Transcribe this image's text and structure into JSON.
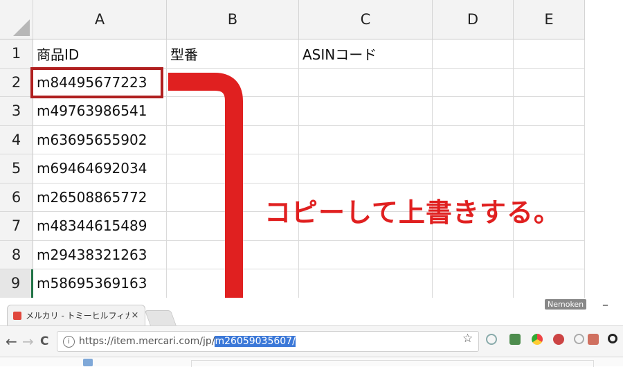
{
  "spreadsheet": {
    "columns": [
      "A",
      "B",
      "C",
      "D",
      "E"
    ],
    "rows": [
      {
        "num": "1",
        "a": "商品ID",
        "b": "型番",
        "c": "ASINコード"
      },
      {
        "num": "2",
        "a": "m84495677223",
        "b": "",
        "c": ""
      },
      {
        "num": "3",
        "a": "m49763986541",
        "b": "",
        "c": ""
      },
      {
        "num": "4",
        "a": "m63695655902",
        "b": "",
        "c": ""
      },
      {
        "num": "5",
        "a": "m69464692034",
        "b": "",
        "c": ""
      },
      {
        "num": "6",
        "a": "m26508865772",
        "b": "",
        "c": ""
      },
      {
        "num": "7",
        "a": "m48344615489",
        "b": "",
        "c": ""
      },
      {
        "num": "8",
        "a": "m29438321263",
        "b": "",
        "c": ""
      },
      {
        "num": "9",
        "a": "m58695369163",
        "b": "",
        "c": ""
      }
    ],
    "selected_row": "9"
  },
  "annotation": {
    "text": "コピーして上書きする。",
    "color": "#e02020",
    "highlight_color": "#b01f1f"
  },
  "browser": {
    "tab_title": "メルカリ - トミーヒルフィガー ウ",
    "tab_close": "×",
    "profile_name": "Nemoken",
    "minimize": "–",
    "back": "←",
    "forward": "→",
    "reload": "C",
    "info": "i",
    "url_prefix": "https://item.mercari.com/jp/",
    "url_selected": "m26059035607",
    "url_suffix": "/",
    "star": "☆",
    "selection_color": "#3b78d8"
  }
}
